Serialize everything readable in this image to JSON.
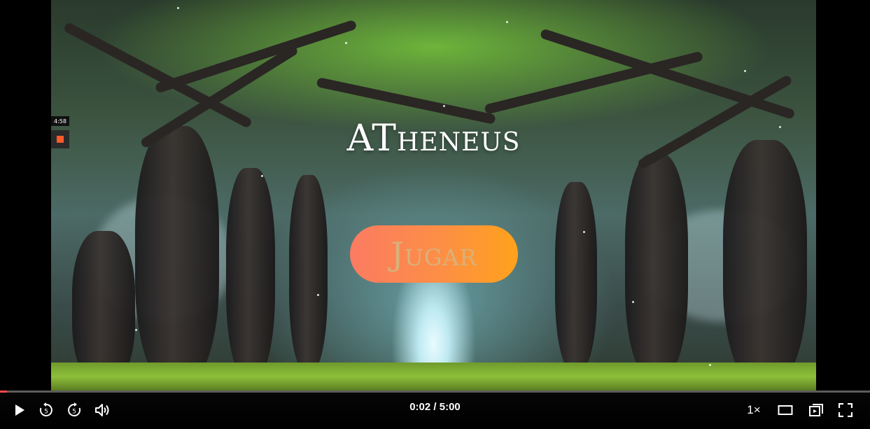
{
  "video": {
    "game_title": "ATheneus",
    "play_button_label": "Jugar",
    "side_badge": "4:58"
  },
  "player": {
    "current_time": "0:02",
    "separator": "/",
    "duration": "5:00",
    "progress": 0.008,
    "speed": "1×",
    "rewind_seconds": "5",
    "forward_seconds": "5",
    "icons": [
      "play-icon",
      "rewind-5-icon",
      "forward-5-icon",
      "volume-icon",
      "theater-mode-icon",
      "miniplayer-icon",
      "fullscreen-icon"
    ],
    "accent_color": "#ff4b4b"
  }
}
